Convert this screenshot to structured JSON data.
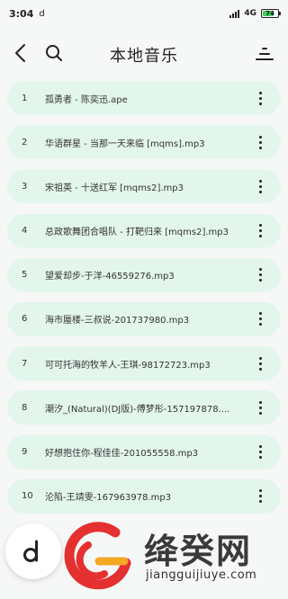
{
  "status": {
    "time": "3:04",
    "app_glyph": "d",
    "network": "4G",
    "battery": "74",
    "battery_level": 0.74
  },
  "header": {
    "title": "本地音乐",
    "back_icon": "back-arrow-icon",
    "search_icon": "search-icon",
    "sort_icon": "sort-icon"
  },
  "songs": [
    {
      "num": "1",
      "title": "孤勇者 - 陈奕迅.ape"
    },
    {
      "num": "2",
      "title": "华语群星 - 当那一天来临 [mqms].mp3"
    },
    {
      "num": "3",
      "title": "宋祖英 - 十送红军 [mqms2].mp3"
    },
    {
      "num": "4",
      "title": "总政歌舞团合唱队 - 打靶归来 [mqms2].mp3"
    },
    {
      "num": "5",
      "title": "望爱却步-于洋-46559276.mp3"
    },
    {
      "num": "6",
      "title": "海市蜃楼-三叔说-201737980.mp3"
    },
    {
      "num": "7",
      "title": "可可托海的牧羊人-王琪-98172723.mp3"
    },
    {
      "num": "8",
      "title": "潮汐_(Natural)(DJ版)-傅梦彤-157197878...."
    },
    {
      "num": "9",
      "title": "好想抱住你-程佳佳-201055558.mp3"
    },
    {
      "num": "10",
      "title": "沦陷-王靖雯-167963978.mp3"
    }
  ],
  "colors": {
    "row_bg": "#e2f6ec",
    "accent_green": "#3ecf5c",
    "watermark_red": "#e53030",
    "watermark_orange": "#f5a623"
  },
  "watermark": {
    "brand": "绛癸网",
    "url": "jiangguijiuye.com"
  }
}
